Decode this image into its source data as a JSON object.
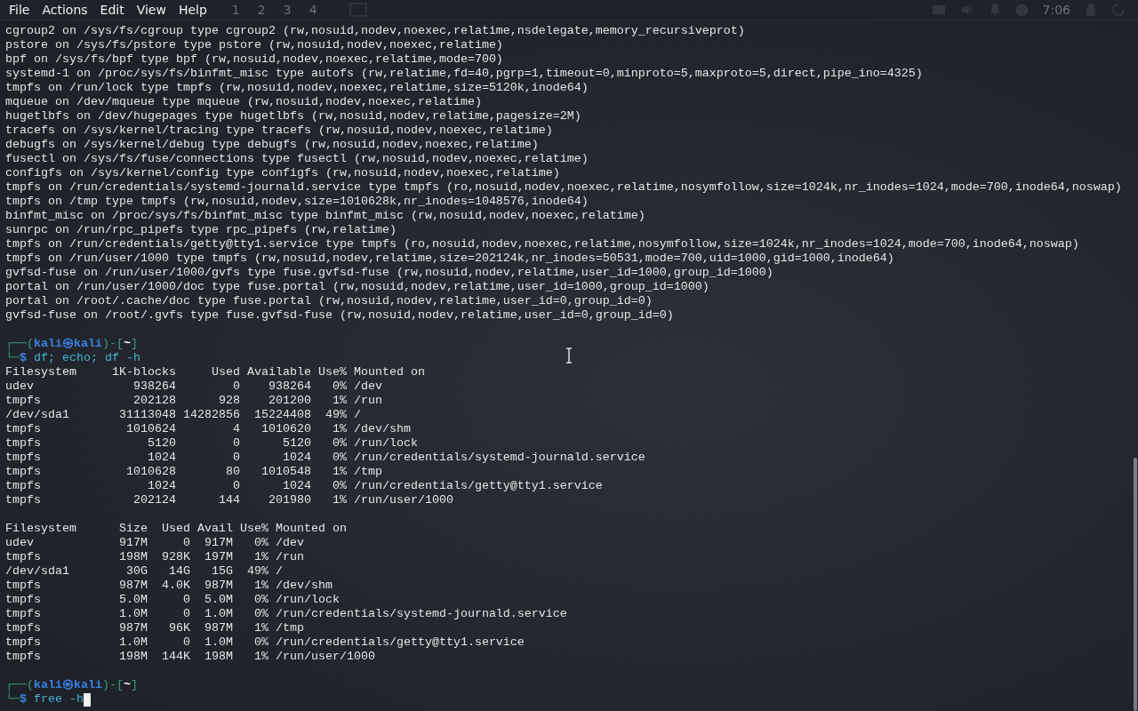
{
  "menu_bar": {
    "items": [
      "File",
      "Actions",
      "Edit",
      "View",
      "Help"
    ]
  },
  "panel": {
    "workspaces": [
      "1",
      "2",
      "3",
      "4"
    ],
    "clock": "7:06"
  },
  "terminal": {
    "lines": [
      {
        "kind": "output",
        "text": "cgroup2 on /sys/fs/cgroup type cgroup2 (rw,nosuid,nodev,noexec,relatime,nsdelegate,memory_recursiveprot)"
      },
      {
        "kind": "output",
        "text": "pstore on /sys/fs/pstore type pstore (rw,nosuid,nodev,noexec,relatime)"
      },
      {
        "kind": "output",
        "text": "bpf on /sys/fs/bpf type bpf (rw,nosuid,nodev,noexec,relatime,mode=700)"
      },
      {
        "kind": "output",
        "text": "systemd-1 on /proc/sys/fs/binfmt_misc type autofs (rw,relatime,fd=40,pgrp=1,timeout=0,minproto=5,maxproto=5,direct,pipe_ino=4325)"
      },
      {
        "kind": "output",
        "text": "tmpfs on /run/lock type tmpfs (rw,nosuid,nodev,noexec,relatime,size=5120k,inode64)"
      },
      {
        "kind": "output",
        "text": "mqueue on /dev/mqueue type mqueue (rw,nosuid,nodev,noexec,relatime)"
      },
      {
        "kind": "output",
        "text": "hugetlbfs on /dev/hugepages type hugetlbfs (rw,nosuid,nodev,relatime,pagesize=2M)"
      },
      {
        "kind": "output",
        "text": "tracefs on /sys/kernel/tracing type tracefs (rw,nosuid,nodev,noexec,relatime)"
      },
      {
        "kind": "output",
        "text": "debugfs on /sys/kernel/debug type debugfs (rw,nosuid,nodev,noexec,relatime)"
      },
      {
        "kind": "output",
        "text": "fusectl on /sys/fs/fuse/connections type fusectl (rw,nosuid,nodev,noexec,relatime)"
      },
      {
        "kind": "output",
        "text": "configfs on /sys/kernel/config type configfs (rw,nosuid,nodev,noexec,relatime)"
      },
      {
        "kind": "output",
        "text": "tmpfs on /run/credentials/systemd-journald.service type tmpfs (ro,nosuid,nodev,noexec,relatime,nosymfollow,size=1024k,nr_inodes=1024,mode=700,inode64,noswap)"
      },
      {
        "kind": "output",
        "text": "tmpfs on /tmp type tmpfs (rw,nosuid,nodev,size=1010628k,nr_inodes=1048576,inode64)"
      },
      {
        "kind": "output",
        "text": "binfmt_misc on /proc/sys/fs/binfmt_misc type binfmt_misc (rw,nosuid,nodev,noexec,relatime)"
      },
      {
        "kind": "output",
        "text": "sunrpc on /run/rpc_pipefs type rpc_pipefs (rw,relatime)"
      },
      {
        "kind": "output",
        "text": "tmpfs on /run/credentials/getty@tty1.service type tmpfs (ro,nosuid,nodev,noexec,relatime,nosymfollow,size=1024k,nr_inodes=1024,mode=700,inode64,noswap)"
      },
      {
        "kind": "output",
        "text": "tmpfs on /run/user/1000 type tmpfs (rw,nosuid,nodev,relatime,size=202124k,nr_inodes=50531,mode=700,uid=1000,gid=1000,inode64)"
      },
      {
        "kind": "output",
        "text": "gvfsd-fuse on /run/user/1000/gvfs type fuse.gvfsd-fuse (rw,nosuid,nodev,relatime,user_id=1000,group_id=1000)"
      },
      {
        "kind": "output",
        "text": "portal on /run/user/1000/doc type fuse.portal (rw,nosuid,nodev,relatime,user_id=1000,group_id=1000)"
      },
      {
        "kind": "output",
        "text": "portal on /root/.cache/doc type fuse.portal (rw,nosuid,nodev,relatime,user_id=0,group_id=0)"
      },
      {
        "kind": "output",
        "text": "gvfsd-fuse on /root/.gvfs type fuse.gvfsd-fuse (rw,nosuid,nodev,relatime,user_id=0,group_id=0)"
      },
      {
        "kind": "blank"
      },
      {
        "kind": "prompt",
        "top_left": "┌──(",
        "user": "kali",
        "at": "㉿",
        "host": "kali",
        "join": ")-[",
        "dir": "~",
        "end": "]",
        "bottom_left": "└─",
        "symbol": "$",
        "command": "df; echo; df -h",
        "cursor": false
      },
      {
        "kind": "output",
        "text": "Filesystem     1K-blocks     Used Available Use% Mounted on"
      },
      {
        "kind": "output",
        "text": "udev              938264        0    938264   0% /dev"
      },
      {
        "kind": "output",
        "text": "tmpfs             202128      928    201200   1% /run"
      },
      {
        "kind": "output",
        "text": "/dev/sda1       31113048 14282856  15224408  49% /"
      },
      {
        "kind": "output",
        "text": "tmpfs            1010624        4   1010620   1% /dev/shm"
      },
      {
        "kind": "output",
        "text": "tmpfs               5120        0      5120   0% /run/lock"
      },
      {
        "kind": "output",
        "text": "tmpfs               1024        0      1024   0% /run/credentials/systemd-journald.service"
      },
      {
        "kind": "output",
        "text": "tmpfs            1010628       80   1010548   1% /tmp"
      },
      {
        "kind": "output",
        "text": "tmpfs               1024        0      1024   0% /run/credentials/getty@tty1.service"
      },
      {
        "kind": "output",
        "text": "tmpfs             202124      144    201980   1% /run/user/1000"
      },
      {
        "kind": "blank"
      },
      {
        "kind": "output",
        "text": "Filesystem      Size  Used Avail Use% Mounted on"
      },
      {
        "kind": "output",
        "text": "udev            917M     0  917M   0% /dev"
      },
      {
        "kind": "output",
        "text": "tmpfs           198M  928K  197M   1% /run"
      },
      {
        "kind": "output",
        "text": "/dev/sda1        30G   14G   15G  49% /"
      },
      {
        "kind": "output",
        "text": "tmpfs           987M  4.0K  987M   1% /dev/shm"
      },
      {
        "kind": "output",
        "text": "tmpfs           5.0M     0  5.0M   0% /run/lock"
      },
      {
        "kind": "output",
        "text": "tmpfs           1.0M     0  1.0M   0% /run/credentials/systemd-journald.service"
      },
      {
        "kind": "output",
        "text": "tmpfs           987M   96K  987M   1% /tmp"
      },
      {
        "kind": "output",
        "text": "tmpfs           1.0M     0  1.0M   0% /run/credentials/getty@tty1.service"
      },
      {
        "kind": "output",
        "text": "tmpfs           198M  144K  198M   1% /run/user/1000"
      },
      {
        "kind": "blank"
      },
      {
        "kind": "prompt",
        "top_left": "┌──(",
        "user": "kali",
        "at": "㉿",
        "host": "kali",
        "join": ")-[",
        "dir": "~",
        "end": "]",
        "bottom_left": "└─",
        "symbol": "$",
        "command": "free -h",
        "cursor": true
      }
    ]
  }
}
